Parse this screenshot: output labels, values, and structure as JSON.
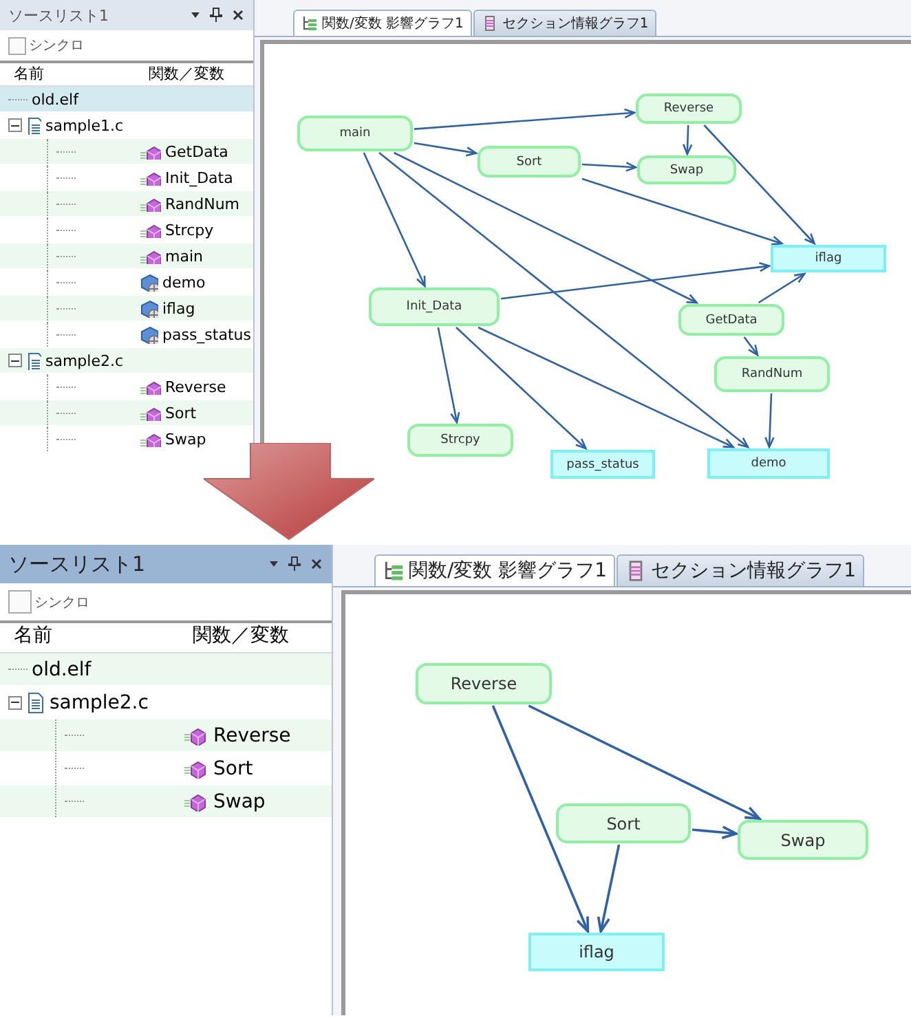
{
  "screens": [
    {
      "source_list": {
        "title": "ソースリスト1",
        "sync": {
          "label": "シンクロ",
          "checked": false
        },
        "columns": [
          "名前",
          "関数／変数"
        ],
        "items": [
          {
            "name": "old.elf",
            "kind": "elf",
            "selected": true
          },
          {
            "name": "sample1.c",
            "kind": "file",
            "selected": false,
            "expanded": true,
            "children": [
              {
                "name": "GetData",
                "kind": "function",
                "selected": false
              },
              {
                "name": "Init_Data",
                "kind": "function",
                "selected": false
              },
              {
                "name": "RandNum",
                "kind": "function",
                "selected": false
              },
              {
                "name": "Strcpy",
                "kind": "function",
                "selected": false
              },
              {
                "name": "main",
                "kind": "function",
                "selected": false
              },
              {
                "name": "demo",
                "kind": "variable",
                "selected": false
              },
              {
                "name": "iflag",
                "kind": "variable",
                "selected": false
              },
              {
                "name": "pass_status",
                "kind": "variable",
                "selected": false
              }
            ]
          },
          {
            "name": "sample2.c",
            "kind": "file",
            "selected": false,
            "expanded": true,
            "children": [
              {
                "name": "Reverse",
                "kind": "function",
                "selected": false
              },
              {
                "name": "Sort",
                "kind": "function",
                "selected": false
              },
              {
                "name": "Swap",
                "kind": "function",
                "selected": false
              }
            ]
          }
        ]
      },
      "tabs": [
        {
          "label": "関数/変数 影響グラフ1",
          "kind": "impact",
          "selected": true
        },
        {
          "label": "セクション情報グラフ1",
          "kind": "section",
          "selected": false
        }
      ],
      "graph": {
        "nodes": [
          {
            "label": "main",
            "kind": "function"
          },
          {
            "label": "Reverse",
            "kind": "function"
          },
          {
            "label": "Sort",
            "kind": "function"
          },
          {
            "label": "Swap",
            "kind": "function"
          },
          {
            "label": "iflag",
            "kind": "variable"
          },
          {
            "label": "Init_Data",
            "kind": "function"
          },
          {
            "label": "GetData",
            "kind": "function"
          },
          {
            "label": "RandNum",
            "kind": "function"
          },
          {
            "label": "Strcpy",
            "kind": "function"
          },
          {
            "label": "pass_status",
            "kind": "variable"
          },
          {
            "label": "demo",
            "kind": "variable"
          }
        ]
      }
    },
    {
      "source_list": {
        "title": "ソースリスト1",
        "sync": {
          "label": "シンクロ",
          "checked": false
        },
        "columns": [
          "名前",
          "関数／変数"
        ],
        "items": [
          {
            "name": "old.elf",
            "kind": "elf",
            "selected": false
          },
          {
            "name": "sample2.c",
            "kind": "file",
            "selected": false,
            "expanded": true,
            "children": [
              {
                "name": "Reverse",
                "kind": "function",
                "selected": false
              },
              {
                "name": "Sort",
                "kind": "function",
                "selected": false
              },
              {
                "name": "Swap",
                "kind": "function",
                "selected": false
              }
            ]
          }
        ]
      },
      "tabs": [
        {
          "label": "関数/変数 影響グラフ1",
          "kind": "impact",
          "selected": true
        },
        {
          "label": "セクション情報グラフ1",
          "kind": "section",
          "selected": false
        }
      ],
      "graph": {
        "nodes": [
          {
            "label": "Reverse",
            "kind": "function"
          },
          {
            "label": "Sort",
            "kind": "function"
          },
          {
            "label": "Swap",
            "kind": "function"
          },
          {
            "label": "iflag",
            "kind": "variable"
          }
        ]
      }
    }
  ]
}
